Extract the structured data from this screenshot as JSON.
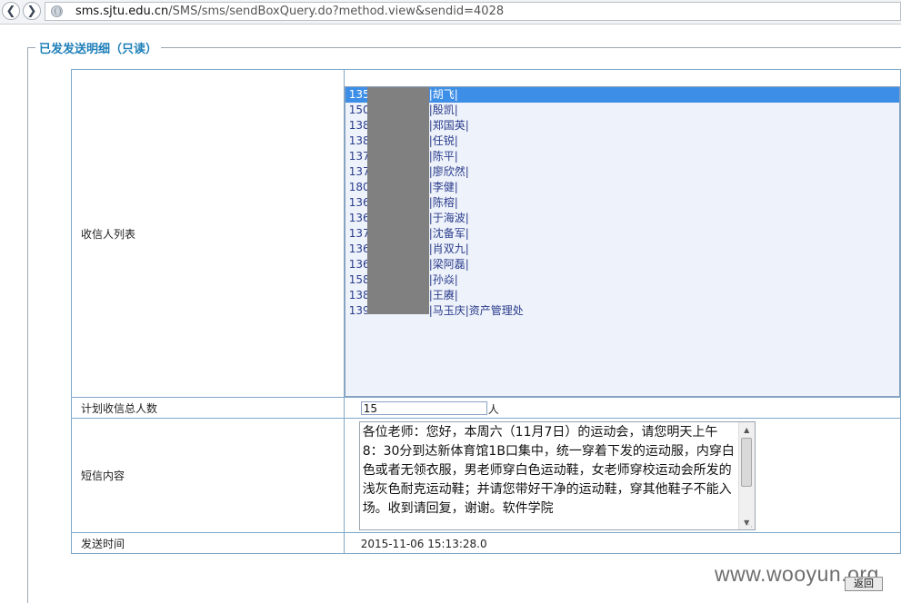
{
  "browser": {
    "url_host": "sms.sjtu.edu.cn",
    "url_path": "/SMS/sms/sendBoxQuery.do?method.view&sendid=4028"
  },
  "page": {
    "legend": "已发发送明细（只读）"
  },
  "detail": {
    "recipients_label": "收信人列表",
    "recipients": [
      {
        "prefix": "135",
        "suffix": "|胡飞|"
      },
      {
        "prefix": "150",
        "suffix": "|殷凯|"
      },
      {
        "prefix": "138",
        "suffix": "|郑国英|"
      },
      {
        "prefix": "138",
        "suffix": "|任锐|"
      },
      {
        "prefix": "137",
        "suffix": "|陈平|"
      },
      {
        "prefix": "137",
        "suffix": "|廖欣然|"
      },
      {
        "prefix": "180",
        "suffix": "|李健|"
      },
      {
        "prefix": "136",
        "suffix": "|陈榕|"
      },
      {
        "prefix": "136",
        "suffix": "|于海波|"
      },
      {
        "prefix": "137",
        "suffix": "|沈备军|"
      },
      {
        "prefix": "136",
        "suffix": "|肖双九|"
      },
      {
        "prefix": "136",
        "suffix": "|梁阿磊|"
      },
      {
        "prefix": "158",
        "suffix": "|孙焱|"
      },
      {
        "prefix": "138",
        "suffix": "|王赓|"
      },
      {
        "prefix": "139",
        "suffix": "|马玉庆|资产管理处"
      }
    ],
    "count_label": "计划收信总人数",
    "count_value": "15",
    "count_unit": "人",
    "sms_label": "短信内容",
    "sms_content": "各位老师：您好，本周六（11月7日）的运动会，请您明天上午8：30分到达新体育馆1B口集中，统一穿着下发的运动服，内穿白色或者无领衣服，男老师穿白色运动鞋，女老师穿校运动会所发的浅灰色耐克运动鞋；并请您带好干净的运动鞋，穿其他鞋子不能入场。收到请回复，谢谢。软件学院",
    "time_label": "发送时间",
    "time_value": "2015-11-06 15:13:28.0"
  },
  "actions": {
    "back_label": "返回"
  },
  "watermark": "www.wooyun.org"
}
